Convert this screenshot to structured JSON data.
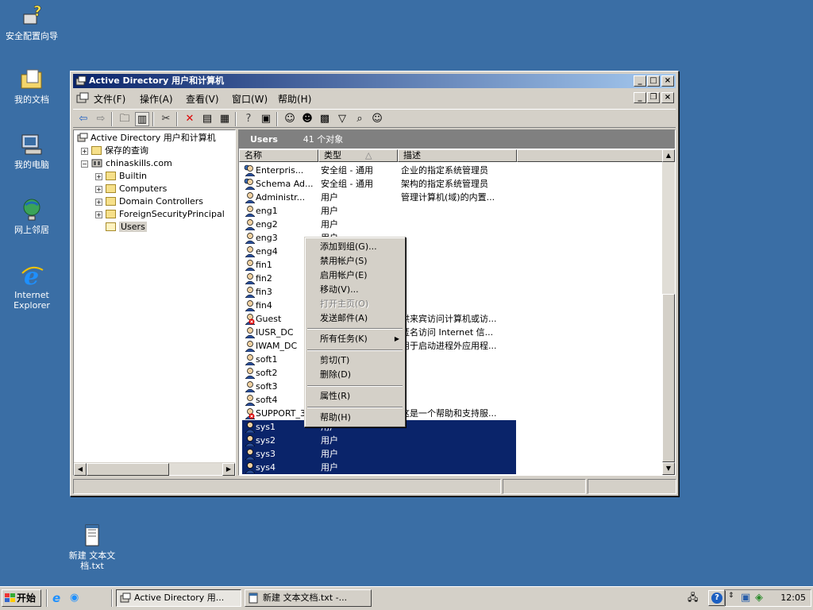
{
  "desktop": {
    "icons": [
      {
        "label": "安全配置向导"
      },
      {
        "label": "我的文档"
      },
      {
        "label": "我的电脑"
      },
      {
        "label": "网上邻居"
      },
      {
        "label": "Internet Explorer"
      },
      {
        "label": "新建 文本文档.txt"
      }
    ]
  },
  "window": {
    "title": "Active Directory 用户和计算机",
    "menus": [
      "文件(F)",
      "操作(A)",
      "查看(V)",
      "窗口(W)",
      "帮助(H)"
    ],
    "tree": {
      "root": "Active Directory 用户和计算机",
      "saved_queries": "保存的查询",
      "domain": "chinaskills.com",
      "children": [
        "Builtin",
        "Computers",
        "Domain Controllers",
        "ForeignSecurityPrincipal",
        "Users"
      ]
    },
    "list": {
      "header_title": "Users",
      "header_count": "41 个对象",
      "columns": [
        "名称",
        "类型",
        "描述"
      ],
      "rows": [
        {
          "name": "Enterpris...",
          "type": "安全组 - 通用",
          "desc": "企业的指定系统管理员"
        },
        {
          "name": "Schema Ad...",
          "type": "安全组 - 通用",
          "desc": "架构的指定系统管理员"
        },
        {
          "name": "Administr...",
          "type": "用户",
          "desc": "管理计算机(域)的内置..."
        },
        {
          "name": "eng1",
          "type": "用户",
          "desc": ""
        },
        {
          "name": "eng2",
          "type": "用户",
          "desc": ""
        },
        {
          "name": "eng3",
          "type": "用户",
          "desc": ""
        },
        {
          "name": "eng4",
          "type": "",
          "desc": ""
        },
        {
          "name": "fin1",
          "type": "",
          "desc": ""
        },
        {
          "name": "fin2",
          "type": "",
          "desc": ""
        },
        {
          "name": "fin3",
          "type": "",
          "desc": ""
        },
        {
          "name": "fin4",
          "type": "",
          "desc": ""
        },
        {
          "name": "Guest",
          "type": "",
          "desc": "供来宾访问计算机或访..."
        },
        {
          "name": "IUSR_DC",
          "type": "",
          "desc": "匿名访问 Internet 信..."
        },
        {
          "name": "IWAM_DC",
          "type": "",
          "desc": "用于启动进程外应用程..."
        },
        {
          "name": "soft1",
          "type": "",
          "desc": ""
        },
        {
          "name": "soft2",
          "type": "",
          "desc": ""
        },
        {
          "name": "soft3",
          "type": "",
          "desc": ""
        },
        {
          "name": "soft4",
          "type": "",
          "desc": ""
        },
        {
          "name": "SUPPORT_3...",
          "type": "",
          "desc": "这是一个帮助和支持服..."
        },
        {
          "name": "sys1",
          "type": "用户",
          "desc": ""
        },
        {
          "name": "sys2",
          "type": "用户",
          "desc": ""
        },
        {
          "name": "sys3",
          "type": "用户",
          "desc": ""
        },
        {
          "name": "sys4",
          "type": "用户",
          "desc": ""
        }
      ]
    }
  },
  "context_menu": {
    "items": [
      "添加到组(G)...",
      "禁用帐户(S)",
      "启用帐户(E)",
      "移动(V)...",
      "打开主页(O)",
      "发送邮件(A)",
      "所有任务(K)",
      "剪切(T)",
      "删除(D)",
      "属性(R)",
      "帮助(H)"
    ]
  },
  "taskbar": {
    "start": "开始",
    "tasks": [
      "Active Directory 用...",
      "新建 文本文档.txt -..."
    ],
    "clock": "12:05"
  },
  "colors": {
    "desktop": "#3a6ea5",
    "title_start": "#0a246a",
    "title_end": "#a6caf0",
    "selection": "#0a246a"
  }
}
